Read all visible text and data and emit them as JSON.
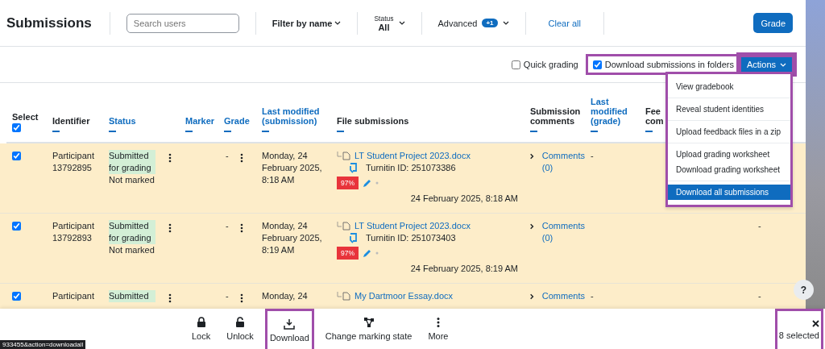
{
  "header": {
    "title": "Submissions",
    "search": {
      "placeholder": "Search users"
    },
    "filter_name": "Filter by name",
    "status_filter": {
      "label": "Status",
      "value": "All"
    },
    "advanced": {
      "label": "Advanced",
      "badge": "+1"
    },
    "clear_all": "Clear all",
    "grade_button": "Grade"
  },
  "toolbar": {
    "options": [
      {
        "label": "Quick grading",
        "checked": false,
        "highlighted": false
      },
      {
        "label": "Download submissions in folders",
        "checked": true,
        "highlighted": true
      }
    ],
    "actions_button": {
      "label": "Actions",
      "highlighted": true
    }
  },
  "actions_menu": {
    "highlighted": true,
    "groups": [
      {
        "items": [
          {
            "label": "View gradebook",
            "selected": false
          }
        ]
      },
      {
        "items": [
          {
            "label": "Reveal student identities",
            "selected": false
          }
        ]
      },
      {
        "items": [
          {
            "label": "Upload feedback files in a zip",
            "selected": false
          }
        ]
      },
      {
        "items": [
          {
            "label": "Upload grading worksheet",
            "selected": false
          },
          {
            "label": "Download grading worksheet",
            "selected": false
          }
        ]
      },
      {
        "items": [
          {
            "label": "Download all submissions",
            "selected": true
          }
        ]
      }
    ]
  },
  "table": {
    "select_all": {
      "label": "Select",
      "checked": true
    },
    "columns": [
      {
        "label": "Identifier",
        "sortable": false
      },
      {
        "label": "Status",
        "sortable": true
      },
      {
        "label": "Marker",
        "sortable": true
      },
      {
        "label": "Grade",
        "sortable": true
      },
      {
        "label": "Last modified (submission)",
        "sortable": true
      },
      {
        "label": "File submissions",
        "sortable": false
      },
      {
        "label": "Submission comments",
        "sortable": false
      },
      {
        "label": "Last modified (grade)",
        "sortable": true
      },
      {
        "label": "Fee com",
        "sortable": false
      }
    ],
    "rows": [
      {
        "selected": true,
        "identifier": "Participant 13792895",
        "status": "Submitted for grading",
        "marking_state": "Not marked",
        "grade": "-",
        "last_modified": "Monday, 24 February 2025, 8:18 AM",
        "file": {
          "name": "LT Student Project 2023.docx",
          "turnitin_id": "Turnitin ID: 251073386",
          "similarity": "97%",
          "date": "24 February 2025, 8:18 AM"
        },
        "comments": {
          "label": "Comments",
          "count": "(0)"
        },
        "grade_modified": "-"
      },
      {
        "selected": true,
        "identifier": "Participant 13792893",
        "status": "Submitted for grading",
        "marking_state": "Not marked",
        "grade": "-",
        "last_modified": "Monday, 24 February 2025, 8:19 AM",
        "file": {
          "name": "LT Student Project 2023.docx",
          "turnitin_id": "Turnitin ID: 251073403",
          "similarity": "97%",
          "date": "24 February 2025, 8:19 AM"
        },
        "comments": {
          "label": "Comments",
          "count": "(0)"
        },
        "feedback": "-"
      },
      {
        "selected": true,
        "identifier": "Participant",
        "status": "Submitted",
        "grade": "-",
        "last_modified": "Monday, 24",
        "file": {
          "name": "My Dartmoor Essay.docx"
        },
        "comments": {
          "label": "Comments"
        },
        "grade_modified": "-",
        "feedback": "-"
      }
    ]
  },
  "bottom_bar": {
    "actions": [
      {
        "kind": "lock",
        "label": "Lock",
        "highlighted": false
      },
      {
        "kind": "unlock",
        "label": "Unlock",
        "highlighted": false
      },
      {
        "kind": "download",
        "label": "Download",
        "highlighted": true
      },
      {
        "kind": "marking",
        "label": "Change marking state",
        "highlighted": false
      },
      {
        "kind": "more",
        "label": "More",
        "highlighted": false
      }
    ],
    "selection": {
      "count": "8 selected",
      "highlighted": true
    }
  },
  "help_button": "?",
  "status_url": "933455&action=downloadall"
}
